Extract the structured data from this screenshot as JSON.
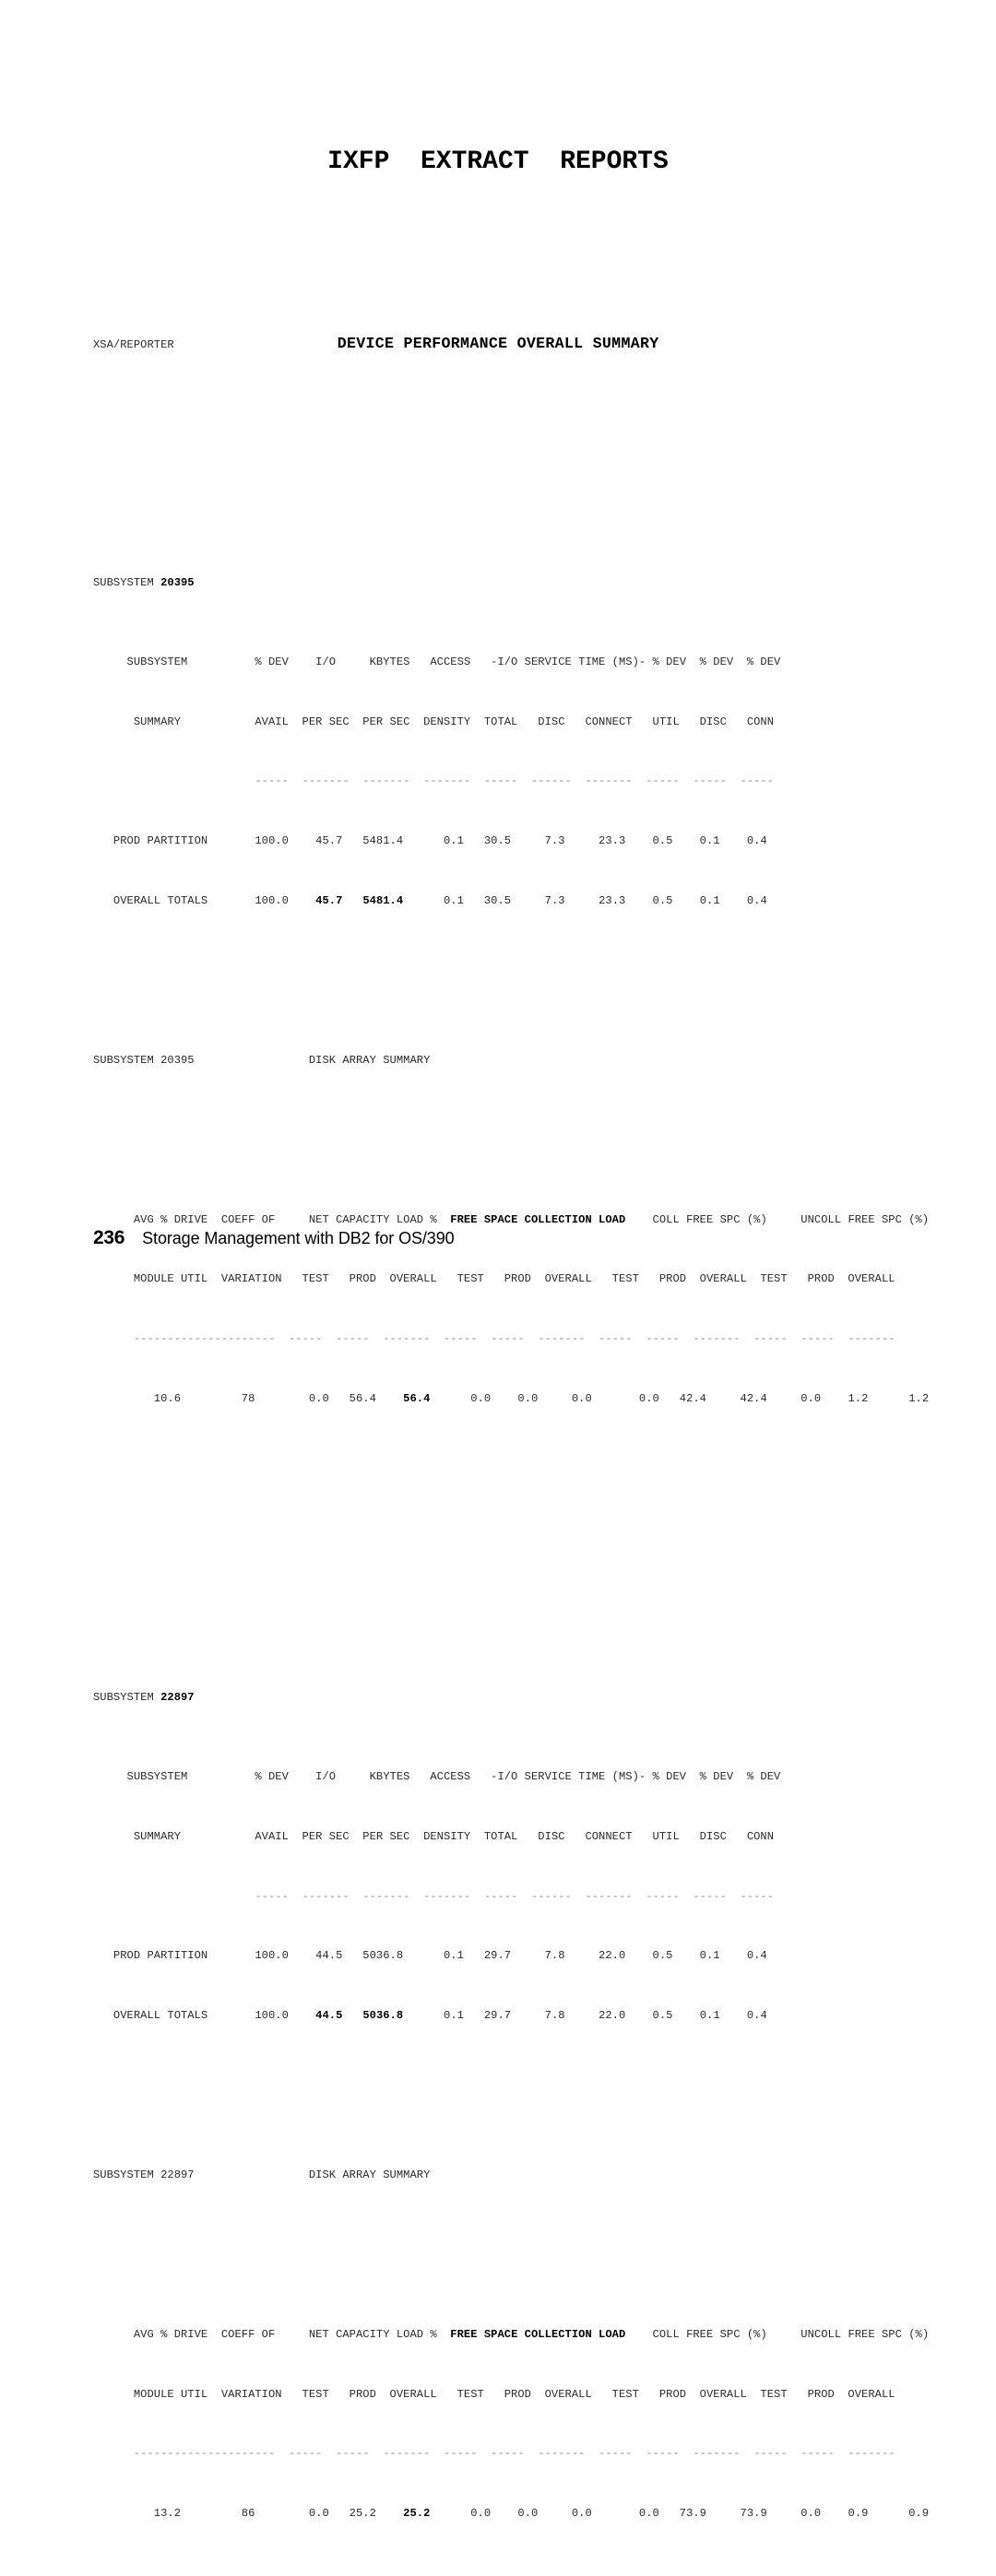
{
  "document": {
    "page_title": "IXFP  EXTRACT  REPORTS",
    "report_source": "XSA/REPORTER",
    "report_title": "DEVICE PERFORMANCE OVERALL SUMMARY",
    "footer": {
      "page_number": "236",
      "book_title": "Storage Management with DB2 for OS/390"
    }
  },
  "lines": {
    "l01": "XSA/REPORTER",
    "l02": "",
    "l03": "",
    "l04": "SUBSYSTEM ",
    "l04b": "20395",
    "l05": "     SUBSYSTEM          % DEV    I/O     KBYTES   ACCESS   -I/O SERVICE TIME (MS)- % DEV  % DEV  % DEV",
    "l06": "      SUMMARY           AVAIL  PER SEC  PER SEC  DENSITY  TOTAL   DISC   CONNECT   UTIL   DISC   CONN",
    "l07": "                        -----  -------  -------  -------  -----  ------  -------  -----  -----  -----",
    "l08": "   PROD PARTITION       100.0    45.7   5481.4      0.1   30.5     7.3     23.3    0.5    0.1    0.4",
    "l09a": "   OVERALL TOTALS       100.0    ",
    "l09b": "45.7",
    "l09c": "   ",
    "l09d": "5481.4",
    "l09e": "      0.1   30.5     7.3     23.3    0.5    0.1    0.4",
    "l10": "",
    "l11": "SUBSYSTEM 20395                 DISK ARRAY SUMMARY",
    "l12": "",
    "l13a": "      AVG % DRIVE  COEFF OF     NET CAPACITY LOAD %  ",
    "l13b": "FREE SPACE COLLECTION LOAD",
    "l13c": "    COLL FREE SPC (%)     UNCOLL FREE SPC (%)",
    "l14": "      MODULE UTIL  VARIATION   TEST   PROD  OVERALL   TEST   PROD  OVERALL   TEST   PROD  OVERALL  TEST   PROD  OVERALL",
    "l15": "      ---------------------  -----  -----  -------  -----  -----  -------  -----  -----  -------  -----  -----  -------",
    "l16a": "         10.6         78        0.0   56.4    ",
    "l16b": "56.4",
    "l16c": "      0.0    0.0     0.0       0.0   42.4     42.4     0.0    1.2      1.2",
    "l17": "",
    "l18": "",
    "l19": "SUBSYSTEM ",
    "l19b": "22897",
    "l20": "     SUBSYSTEM          % DEV    I/O     KBYTES   ACCESS   -I/O SERVICE TIME (MS)- % DEV  % DEV  % DEV",
    "l21": "      SUMMARY           AVAIL  PER SEC  PER SEC  DENSITY  TOTAL   DISC   CONNECT   UTIL   DISC   CONN",
    "l22": "                        -----  -------  -------  -------  -----  ------  -------  -----  -----  -----",
    "l23": "   PROD PARTITION       100.0    44.5   5036.8      0.1   29.7     7.8     22.0    0.5    0.1    0.4",
    "l24a": "   OVERALL TOTALS       100.0    ",
    "l24b": "44.5",
    "l24c": "   ",
    "l24d": "5036.8",
    "l24e": "      0.1   29.7     7.8     22.0    0.5    0.1    0.4",
    "l25": "",
    "l26": "SUBSYSTEM 22897                 DISK ARRAY SUMMARY",
    "l27": "",
    "l28a": "      AVG % DRIVE  COEFF OF     NET CAPACITY LOAD %  ",
    "l28b": "FREE SPACE COLLECTION LOAD",
    "l28c": "    COLL FREE SPC (%)     UNCOLL FREE SPC (%)",
    "l29": "      MODULE UTIL  VARIATION   TEST   PROD  OVERALL   TEST   PROD  OVERALL   TEST   PROD  OVERALL  TEST   PROD  OVERALL",
    "l30": "      ---------------------  -----  -----  -------  -----  -----  -------  -----  -----  -------  -----  -----  -------",
    "l31a": "         13.2         86        0.0   25.2    ",
    "l31b": "25.2",
    "l31c": "      0.0    0.0     0.0       0.0   73.9     73.9     0.0    0.9      0.9"
  },
  "report_data": {
    "subsystems": [
      {
        "id": "20395",
        "device_performance": {
          "section_label": "SUBSYSTEM SUMMARY",
          "column_groups": [
            "% DEV AVAIL",
            "I/O PER SEC",
            "KBYTES PER SEC",
            "ACCESS DENSITY",
            "-I/O SERVICE TIME (MS)- TOTAL",
            "-I/O SERVICE TIME (MS)- DISC",
            "-I/O SERVICE TIME (MS)- CONNECT",
            "% DEV UTIL",
            "% DEV DISC",
            "% DEV CONN"
          ],
          "rows": [
            {
              "label": "PROD PARTITION",
              "values": [
                "100.0",
                "45.7",
                "5481.4",
                "0.1",
                "30.5",
                "7.3",
                "23.3",
                "0.5",
                "0.1",
                "0.4"
              ]
            },
            {
              "label": "OVERALL TOTALS",
              "values": [
                "100.0",
                "45.7",
                "5481.4",
                "0.1",
                "30.5",
                "7.3",
                "23.3",
                "0.5",
                "0.1",
                "0.4"
              ],
              "bold_indices": [
                1,
                2
              ]
            }
          ]
        },
        "disk_array_summary": {
          "title": "DISK ARRAY SUMMARY",
          "column_groups": [
            "AVG % DRIVE MODULE UTIL",
            "COEFF OF VARIATION",
            "NET CAPACITY LOAD % - TEST",
            "NET CAPACITY LOAD % - PROD",
            "NET CAPACITY LOAD % - OVERALL",
            "FREE SPACE COLLECTION LOAD - TEST",
            "FREE SPACE COLLECTION LOAD - PROD",
            "FREE SPACE COLLECTION LOAD - OVERALL",
            "COLL FREE SPC (%) - TEST",
            "COLL FREE SPC (%) - PROD",
            "COLL FREE SPC (%) - OVERALL",
            "UNCOLL FREE SPC (%) - TEST",
            "UNCOLL FREE SPC (%) - PROD",
            "UNCOLL FREE SPC (%) - OVERALL"
          ],
          "values": [
            "10.6",
            "78",
            "0.0",
            "56.4",
            "56.4",
            "0.0",
            "0.0",
            "0.0",
            "0.0",
            "42.4",
            "42.4",
            "0.0",
            "1.2",
            "1.2"
          ],
          "bold_indices": [
            4
          ]
        }
      },
      {
        "id": "22897",
        "device_performance": {
          "section_label": "SUBSYSTEM SUMMARY",
          "rows": [
            {
              "label": "PROD PARTITION",
              "values": [
                "100.0",
                "44.5",
                "5036.8",
                "0.1",
                "29.7",
                "7.8",
                "22.0",
                "0.5",
                "0.1",
                "0.4"
              ]
            },
            {
              "label": "OVERALL TOTALS",
              "values": [
                "100.0",
                "44.5",
                "5036.8",
                "0.1",
                "29.7",
                "7.8",
                "22.0",
                "0.5",
                "0.1",
                "0.4"
              ],
              "bold_indices": [
                1,
                2
              ]
            }
          ]
        },
        "disk_array_summary": {
          "title": "DISK ARRAY SUMMARY",
          "values": [
            "13.2",
            "86",
            "0.0",
            "25.2",
            "25.2",
            "0.0",
            "0.0",
            "0.0",
            "0.0",
            "73.9",
            "73.9",
            "0.0",
            "0.9",
            "0.9"
          ],
          "bold_indices": [
            4
          ]
        }
      }
    ]
  }
}
